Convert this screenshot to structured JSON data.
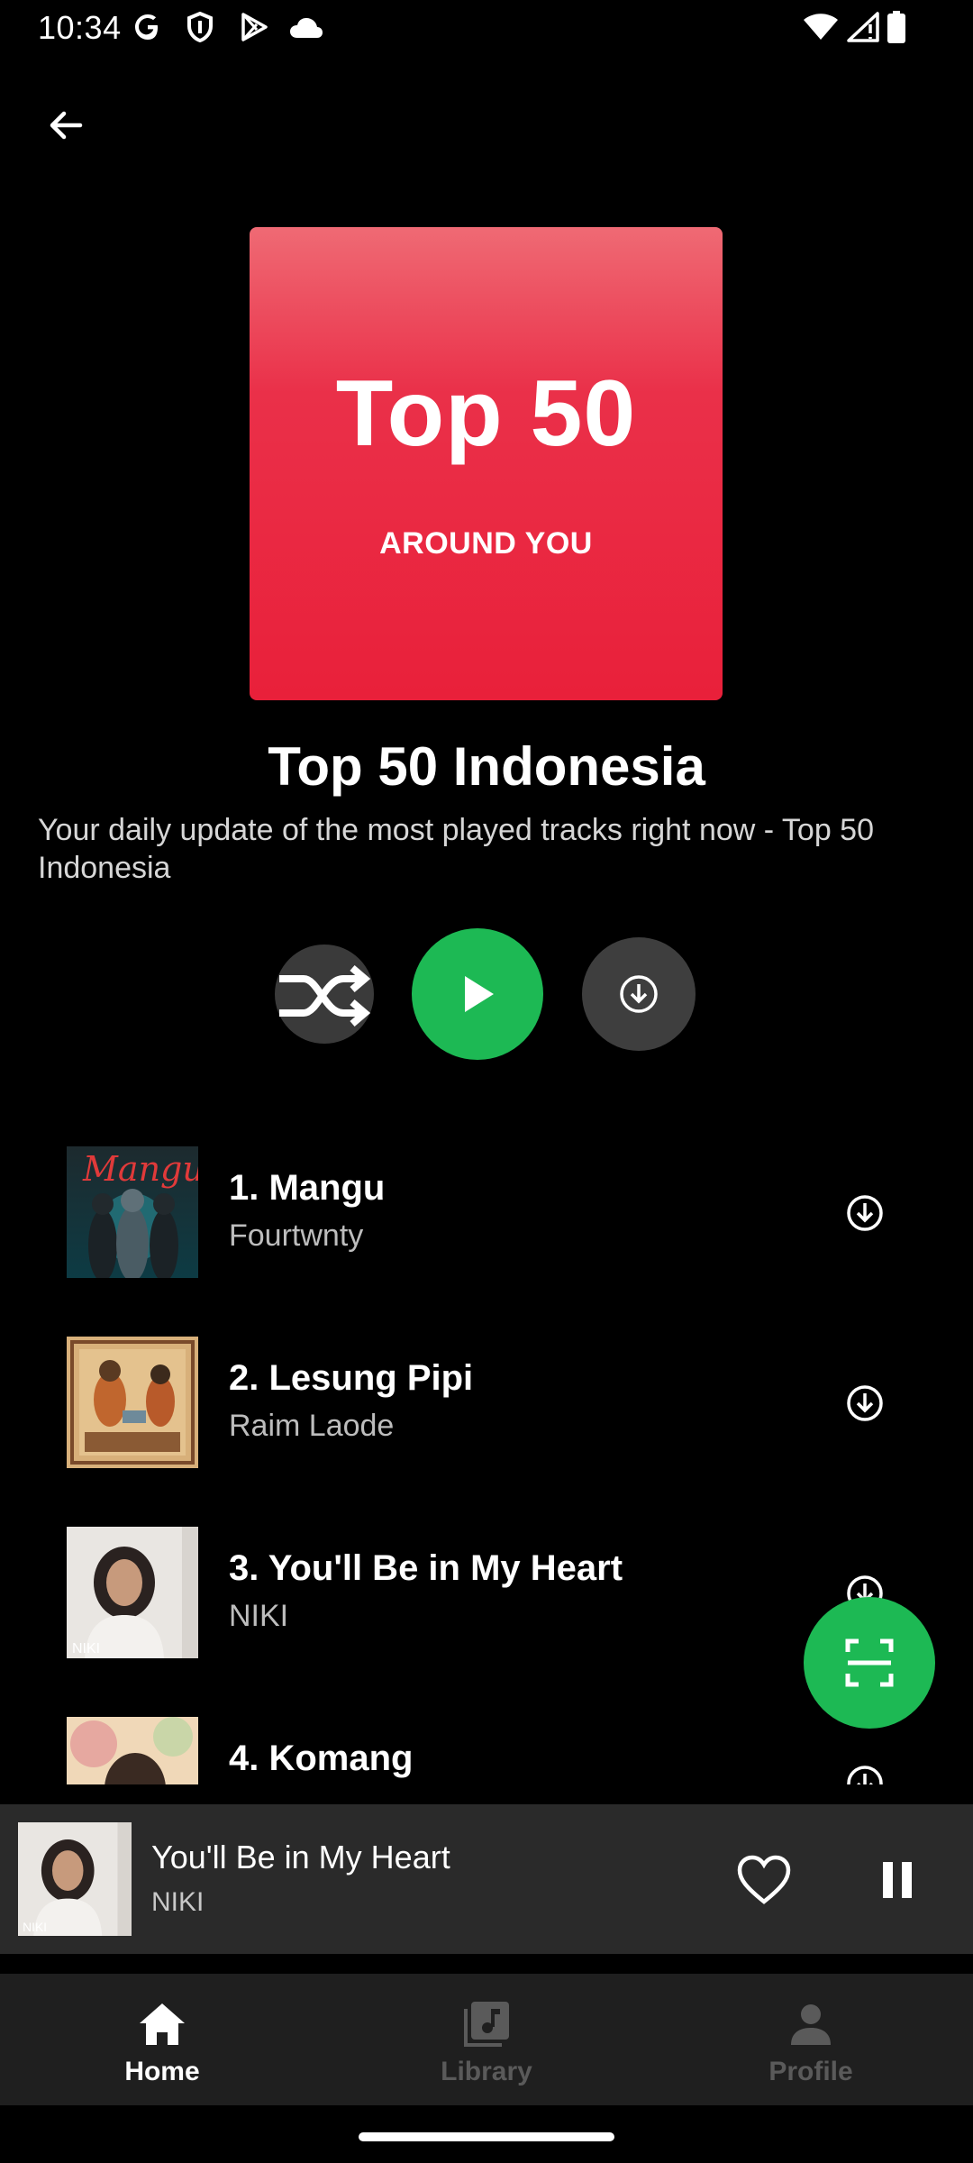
{
  "status_bar": {
    "time": "10:34",
    "icons": [
      "google-icon",
      "shield-icon",
      "play-store-icon",
      "cloud-icon",
      "wifi-icon",
      "signal-icon",
      "battery-icon"
    ]
  },
  "header": {
    "back_icon": "arrow-left-icon"
  },
  "cover": {
    "title": "Top 50",
    "subtitle": "AROUND YOU",
    "color": "#e9203a"
  },
  "playlist": {
    "title": "Top 50 Indonesia",
    "description": "Your daily update of the most played tracks right now - Top 50 Indonesia"
  },
  "controls": {
    "shuffle_icon": "shuffle-icon",
    "play_icon": "play-icon",
    "download_icon": "download-icon",
    "accent": "#1db954"
  },
  "tracks": [
    {
      "title": "1. Mangu",
      "artist": "Fourtwnty",
      "art_label": "Mangu"
    },
    {
      "title": "2. Lesung Pipi",
      "artist": "Raim Laode"
    },
    {
      "title": "3. You'll Be in My Heart",
      "artist": "NIKI",
      "art_label": "NIKI"
    },
    {
      "title": "4. Komang",
      "artist": ""
    }
  ],
  "fab": {
    "icon": "scan-icon"
  },
  "mini_player": {
    "title": "You'll Be in My Heart",
    "artist": "NIKI",
    "art_label": "NIKI",
    "heart_icon": "heart-outline-icon",
    "pause_icon": "pause-icon"
  },
  "nav": {
    "items": [
      {
        "label": "Home",
        "icon": "home-icon",
        "active": true
      },
      {
        "label": "Library",
        "icon": "library-icon",
        "active": false
      },
      {
        "label": "Profile",
        "icon": "profile-icon",
        "active": false
      }
    ]
  }
}
